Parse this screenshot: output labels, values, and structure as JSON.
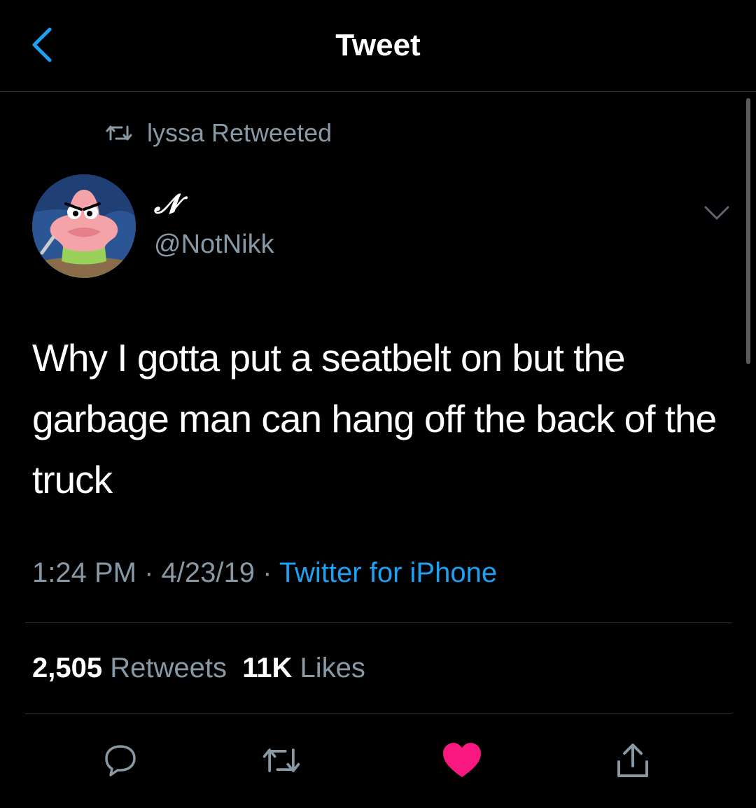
{
  "header": {
    "title": "Tweet",
    "back_icon": "chevron-left-icon"
  },
  "retweet_context": {
    "icon": "retweet-icon",
    "text": "lyssa Retweeted"
  },
  "author": {
    "display_name": "𝓝",
    "handle": "@NotNikk",
    "avatar": "patrick-star-avatar"
  },
  "tweet": {
    "text": "Why I gotta put a seatbelt on but the garbage man can hang off the back of the truck",
    "time": "1:24 PM",
    "date": "4/23/19",
    "separator": " · ",
    "source": "Twitter for iPhone"
  },
  "stats": {
    "retweets_count": "2,505",
    "retweets_label": "Retweets",
    "likes_count": "11K",
    "likes_label": "Likes"
  },
  "actions": {
    "reply_icon": "reply-icon",
    "retweet_icon": "retweet-icon",
    "like_icon": "heart-icon",
    "share_icon": "share-icon"
  },
  "colors": {
    "background": "#000000",
    "accent": "#1da1f2",
    "muted": "#8899a6",
    "like": "#f91880",
    "divider": "#2f3336"
  }
}
